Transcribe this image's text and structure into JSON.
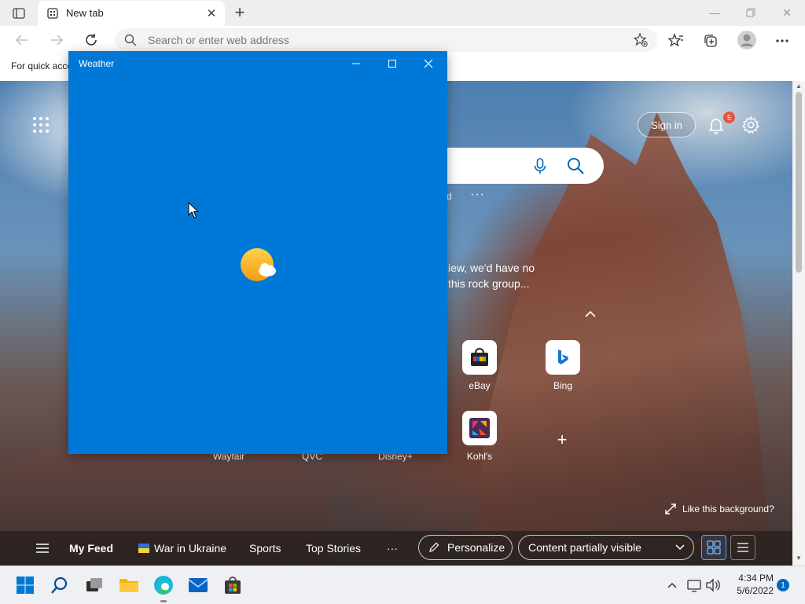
{
  "browser": {
    "tab_title": "New tab",
    "address_placeholder": "Search or enter web address",
    "favorites_bar_text": "For quick acce"
  },
  "ntp": {
    "signin_label": "Sign in",
    "notification_count": "5",
    "quicklinks_fragment": "d",
    "quicklinks_more": "···",
    "caption_line1": "iew, we'd have no",
    "caption_line2": "this rock group...",
    "tiles": [
      {
        "label": "eBay"
      },
      {
        "label": "Bing"
      },
      {
        "label": "Kohl's"
      },
      {
        "label": "Wayfair"
      },
      {
        "label": "QVC"
      },
      {
        "label": "Disney+"
      }
    ],
    "add_tile": "+",
    "like_background": "Like this background?",
    "feed": {
      "my_feed": "My Feed",
      "war_in_ukraine": "War in Ukraine",
      "sports": "Sports",
      "top_stories": "Top Stories",
      "more": "···",
      "personalize": "Personalize",
      "content_visibility": "Content partially visible"
    }
  },
  "weather_window": {
    "title": "Weather"
  },
  "taskbar": {
    "time": "4:34 PM",
    "date": "5/6/2022",
    "notification_count": "1"
  },
  "colors": {
    "weather_blue": "#0078d7",
    "taskbar_bg": "#eef0f3",
    "badge_red": "#e2553f",
    "accent_blue": "#0067c0"
  }
}
